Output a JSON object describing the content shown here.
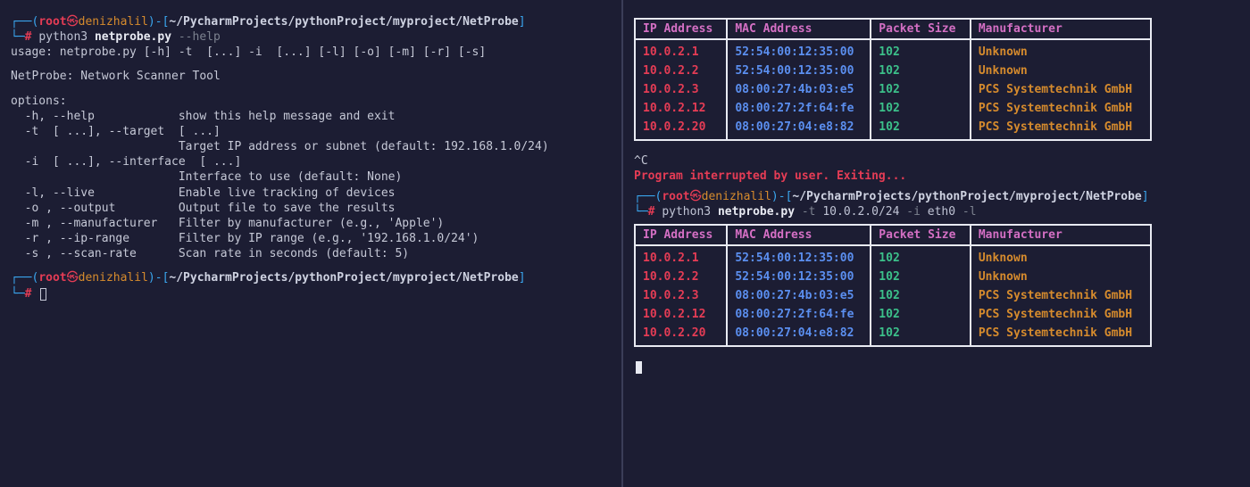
{
  "prompt": {
    "user": "root",
    "sym": "㉿",
    "host": "denizhalil",
    "path": "~/PycharmProjects/pythonProject/myproject/NetProbe",
    "hash": "#"
  },
  "left": {
    "cmd1_a": "python3 ",
    "cmd1_b": "netprobe.py ",
    "cmd1_c": "--help",
    "usage": "usage: netprobe.py [-h] -t  [...] -i  [...] [-l] [-o] [-m] [-r] [-s]",
    "desc": "NetProbe: Network Scanner Tool",
    "opts_header": "options:",
    "opts": [
      "  -h, --help            show this help message and exit",
      "  -t  [ ...], --target  [ ...]",
      "                        Target IP address or subnet (default: 192.168.1.0/24)",
      "  -i  [ ...], --interface  [ ...]",
      "                        Interface to use (default: None)",
      "  -l, --live            Enable live tracking of devices",
      "  -o , --output         Output file to save the results",
      "  -m , --manufacturer   Filter by manufacturer (e.g., 'Apple')",
      "  -r , --ip-range       Filter by IP range (e.g., '192.168.1.0/24')",
      "  -s , --scan-rate      Scan rate in seconds (default: 5)"
    ]
  },
  "right": {
    "headers": {
      "ip": "IP Address",
      "mac": "MAC Address",
      "pkt": "Packet Size",
      "mfr": "Manufacturer"
    },
    "rows": [
      {
        "ip": "10.0.2.1",
        "mac": "52:54:00:12:35:00",
        "pkt": "102",
        "mfr": "Unknown"
      },
      {
        "ip": "10.0.2.2",
        "mac": "52:54:00:12:35:00",
        "pkt": "102",
        "mfr": "Unknown"
      },
      {
        "ip": "10.0.2.3",
        "mac": "08:00:27:4b:03:e5",
        "pkt": "102",
        "mfr": "PCS Systemtechnik GmbH"
      },
      {
        "ip": "10.0.2.12",
        "mac": "08:00:27:2f:64:fe",
        "pkt": "102",
        "mfr": "PCS Systemtechnik GmbH"
      },
      {
        "ip": "10.0.2.20",
        "mac": "08:00:27:04:e8:82",
        "pkt": "102",
        "mfr": "PCS Systemtechnik GmbH"
      }
    ],
    "ctrl_c": "^C",
    "interrupt": "Program interrupted by user. Exiting...",
    "cmd2_a": "python3 ",
    "cmd2_b": "netprobe.py ",
    "cmd2_c": "-t",
    "cmd2_d": " 10.0.2.0/24 ",
    "cmd2_e": "-i",
    "cmd2_f": " eth0 ",
    "cmd2_g": "-l"
  }
}
